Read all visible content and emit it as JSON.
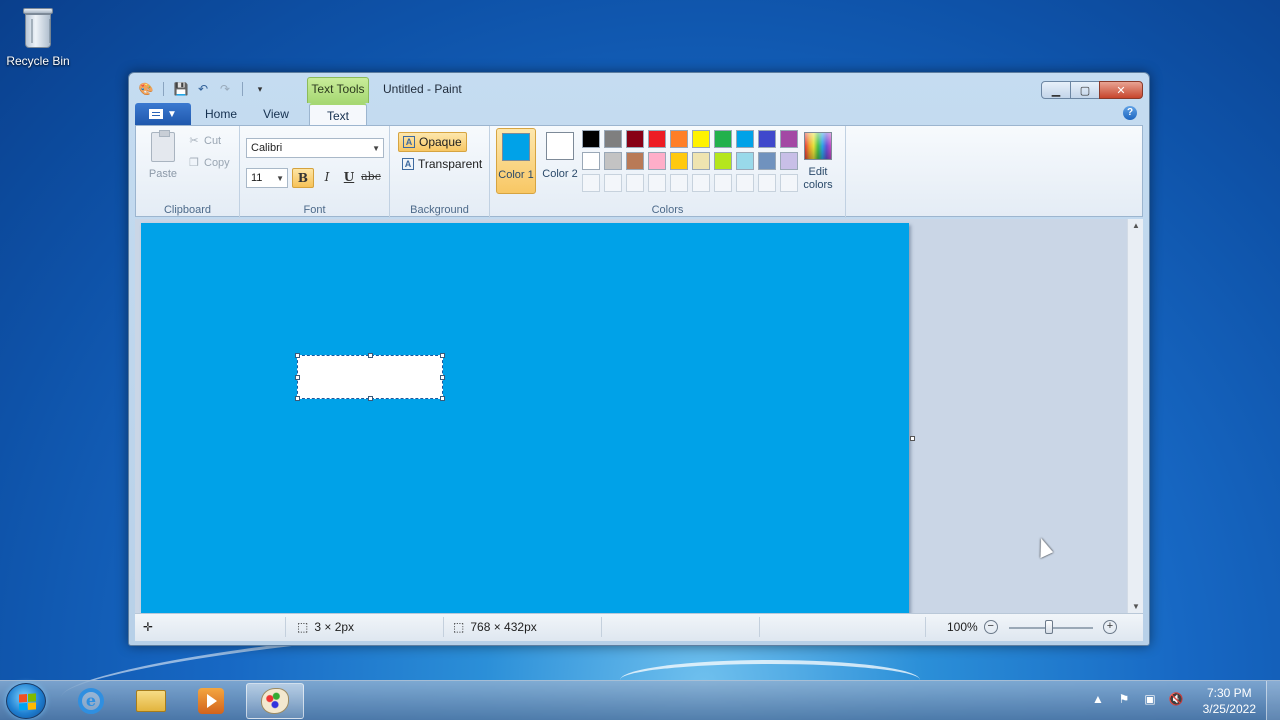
{
  "desktop": {
    "icons": [
      {
        "label": "Recycle Bin",
        "icon": "recycle-bin-icon"
      }
    ]
  },
  "window": {
    "title": "Untitled - Paint",
    "contextual_tab": "Text Tools",
    "quick_access": [
      "save-icon",
      "undo-icon",
      "redo-icon",
      "customize-dropdown-icon"
    ]
  },
  "ribbon": {
    "tabs": [
      {
        "label": "Home"
      },
      {
        "label": "View"
      },
      {
        "label": "Text",
        "active": true
      }
    ],
    "clipboard": {
      "label": "Clipboard",
      "paste": "Paste",
      "cut": "Cut",
      "copy": "Copy"
    },
    "font": {
      "label": "Font",
      "family": "Calibri",
      "size": "11",
      "bold": "B",
      "italic": "I",
      "underline": "U",
      "strikethrough": "abc"
    },
    "background": {
      "label": "Background",
      "opaque": "Opaque",
      "transparent": "Transparent",
      "selected": "Opaque"
    },
    "colors": {
      "label": "Colors",
      "color1": {
        "label": "Color 1",
        "value": "#00a2e8"
      },
      "color2": {
        "label": "Color 2",
        "value": "#ffffff"
      },
      "edit": "Edit colors",
      "palette_row1": [
        "#000000",
        "#7f7f7f",
        "#880015",
        "#ed1c24",
        "#ff7f27",
        "#fff200",
        "#22b14c",
        "#00a2e8",
        "#3f48cc",
        "#a349a4"
      ],
      "palette_row2": [
        "#ffffff",
        "#c3c3c3",
        "#b97a57",
        "#ffaec9",
        "#ffc90e",
        "#efe4b0",
        "#b5e61d",
        "#99d9ea",
        "#7092be",
        "#c8bfe7"
      ]
    }
  },
  "canvas": {
    "background_color": "#00a2e8"
  },
  "status": {
    "selection_size": "3 × 2px",
    "image_size": "768 × 432px",
    "zoom": "100%"
  },
  "taskbar": {
    "apps": [
      "internet-explorer",
      "windows-explorer",
      "media-player",
      "paint"
    ],
    "time": "7:30 PM",
    "date": "3/25/2022"
  }
}
